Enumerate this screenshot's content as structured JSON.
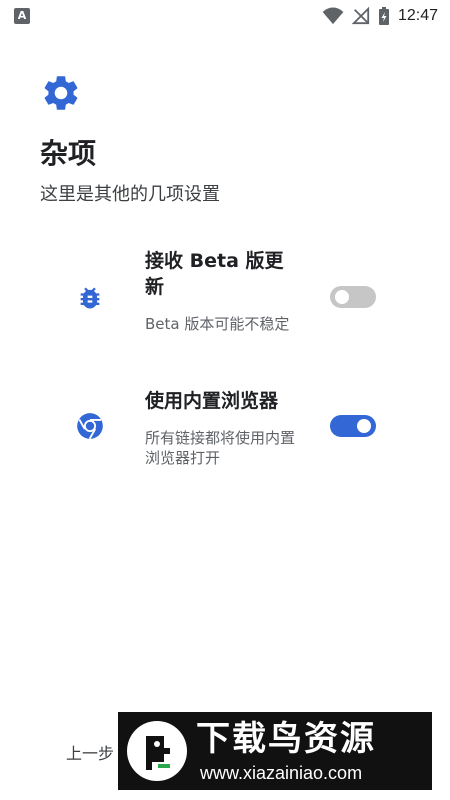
{
  "status_bar": {
    "notification_icon": "text-a-icon",
    "notification_label": "A",
    "wifi_icon": "wifi-icon",
    "signal_icon": "no-signal-icon",
    "battery_icon": "battery-charging-icon",
    "time": "12:47"
  },
  "header": {
    "icon": "gear-icon",
    "title": "杂项",
    "subtitle": "这里是其他的几项设置"
  },
  "settings": [
    {
      "icon": "bug-icon",
      "title": "接收 Beta 版更新",
      "description": "Beta 版本可能不稳定",
      "enabled": false
    },
    {
      "icon": "chrome-icon",
      "title": "使用内置浏览器",
      "description": "所有链接都将使用内置浏览器打开",
      "enabled": true
    }
  ],
  "footer": {
    "prev_label": "上一步"
  },
  "watermark": {
    "title": "下载鸟资源",
    "url": "www.xiazainiao.com"
  },
  "colors": {
    "accent": "#3367d6",
    "toggle_off": "#c6c6c6",
    "text_primary": "#202124",
    "text_secondary": "#5f6368"
  }
}
